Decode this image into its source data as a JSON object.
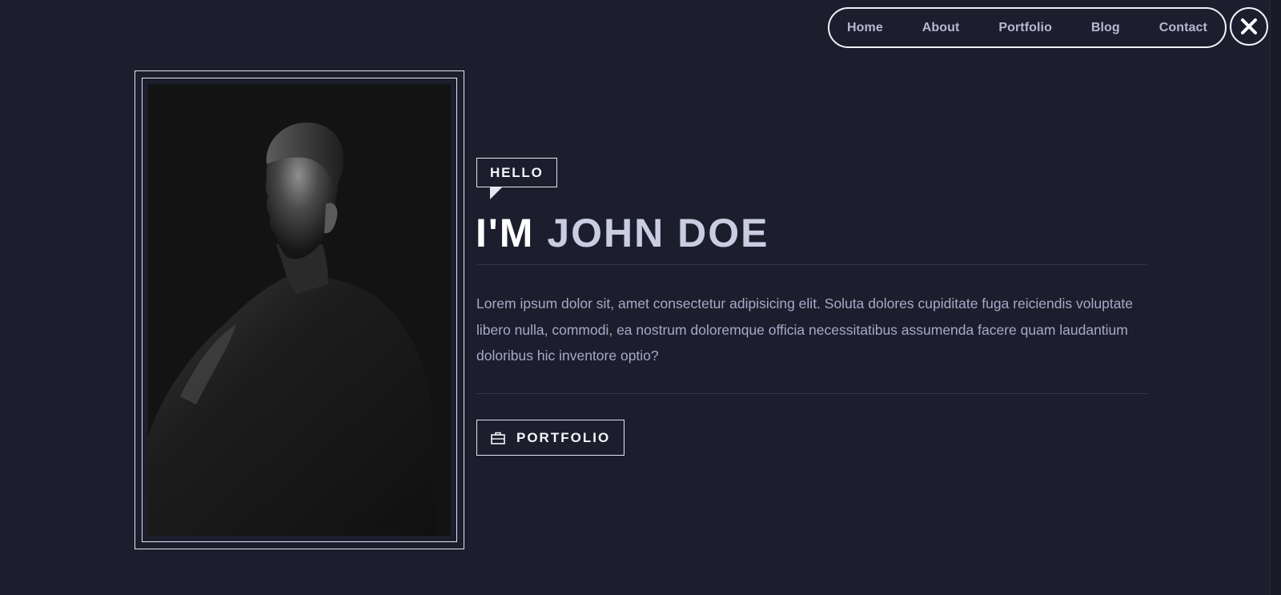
{
  "nav": {
    "items": [
      {
        "label": "Home"
      },
      {
        "label": "About"
      },
      {
        "label": "Portfolio"
      },
      {
        "label": "Blog"
      },
      {
        "label": "Contact"
      }
    ],
    "close_icon": "close-icon"
  },
  "hero": {
    "tag": "HELLO",
    "headline_prefix": "I'M",
    "headline_name": "JOHN DOE",
    "bio": "Lorem ipsum dolor sit, amet consectetur adipisicing elit. Soluta dolores cupiditate fuga reiciendis voluptate libero nulla, commodi, ea nostrum doloremque officia necessitatibus assumenda facere quam laudantium doloribus hic inventore optio?",
    "button_label": "PORTFOLIO",
    "button_icon": "briefcase-icon"
  },
  "photo": {
    "icon": "portrait-photo"
  },
  "colors": {
    "background": "#1c1d2d",
    "accent": "#c9cde2",
    "text_muted": "#a6aac6",
    "border": "#e5e6f0"
  }
}
